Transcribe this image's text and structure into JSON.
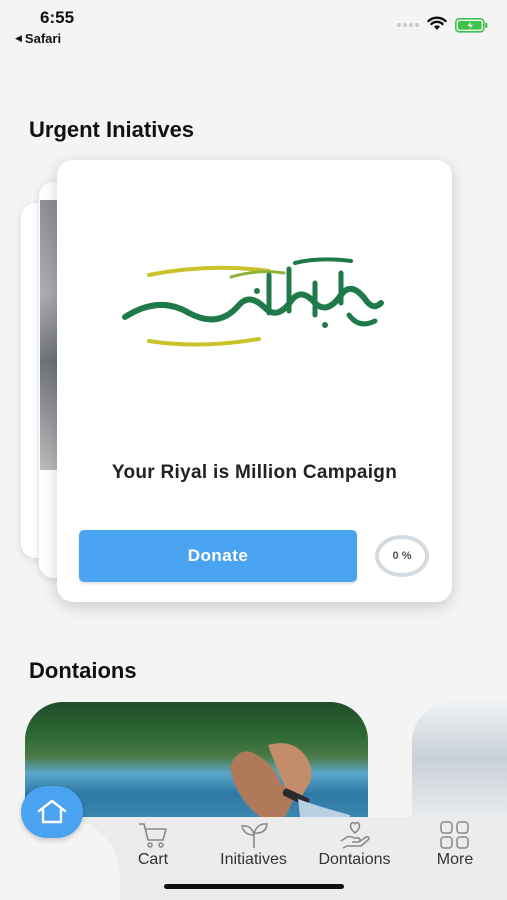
{
  "status_bar": {
    "time": "6:55",
    "back_app": "Safari",
    "back_icon": "back-triangle-icon",
    "battery_color": "#3dc24a"
  },
  "sections": {
    "urgent_title": "Urgent Iniatives",
    "donations_title": "Dontaions"
  },
  "urgent_card": {
    "logo_icon": "riyalkum-million-logo",
    "title": "Your Riyal is Million Campaign",
    "donate_label": "Donate",
    "progress_text": "0 %",
    "progress_fraction": 0
  },
  "bottom_nav": {
    "home_icon": "home-icon",
    "items": [
      {
        "label": "Cart",
        "icon": "cart-icon"
      },
      {
        "label": "Initiatives",
        "icon": "sprout-icon"
      },
      {
        "label": "Dontaions",
        "icon": "hand-heart-icon"
      },
      {
        "label": "More",
        "icon": "grid-icon"
      }
    ]
  },
  "colors": {
    "accent": "#4aa3f0",
    "logo_green": "#1f7a4a",
    "logo_yellow": "#c9c229"
  }
}
